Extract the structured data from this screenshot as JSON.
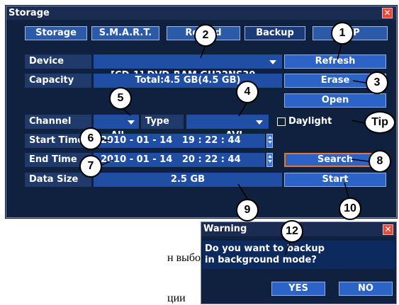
{
  "window": {
    "title": "Storage",
    "tabs": [
      "Storage",
      "S.M.A.R.T.",
      "Record",
      "Backup",
      "FTP"
    ],
    "active_tab": "Backup",
    "rows": {
      "device": {
        "label": "Device",
        "value": "[CD-1] DVD-RAM GH22NS30"
      },
      "capacity": {
        "label": "Capacity",
        "value": "Total:4.5 GB(4.5 GB)"
      },
      "channel": {
        "label": "Channel",
        "value": "All"
      },
      "type": {
        "label": "Type",
        "value": "AVI"
      },
      "daylight": {
        "label": "Daylight",
        "checked": false
      },
      "start_time": {
        "label": "Start Time",
        "value": "2010 - 01 - 14   19 : 22 : 44"
      },
      "end_time": {
        "label": "End Time",
        "value": "2010 - 01 - 14   20 : 22 : 44"
      },
      "data_size": {
        "label": "Data Size",
        "value": "2.5 GB"
      }
    },
    "buttons": {
      "refresh": "Refresh",
      "erase": "Erase",
      "open": "Open",
      "search": "Search",
      "start": "Start"
    }
  },
  "dialog": {
    "title": "Warning",
    "message_line1": "Do you want to backup",
    "message_line2": "in background mode?",
    "yes": "YES",
    "no": "NO"
  },
  "callouts": {
    "c1": "1",
    "c2": "2",
    "c3": "3",
    "c4": "4",
    "c5": "5",
    "c6": "6",
    "c7": "7",
    "c8": "8",
    "c9": "9",
    "c10": "10",
    "c12": "12",
    "tip": "Tip"
  },
  "background_text": {
    "line1": "н  выбор  отдельного",
    "line2": "ции"
  },
  "colors": {
    "window_bg": "#10203f",
    "button_blue": "#2b63c6",
    "focus_orange": "#e9742c",
    "close_red": "#e84a3a"
  }
}
